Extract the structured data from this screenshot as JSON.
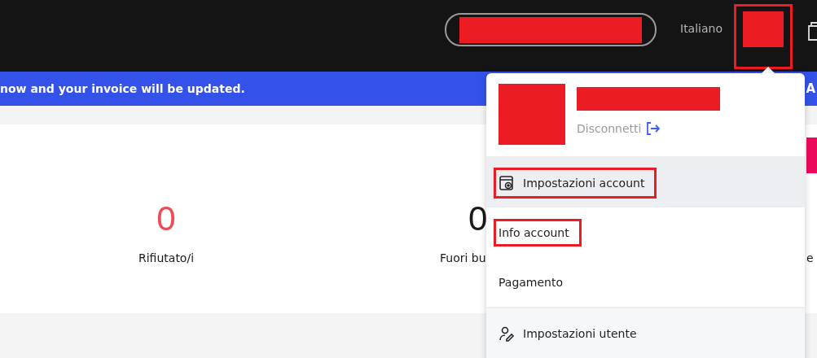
{
  "header": {
    "language": "Italiano",
    "avatar_annotated": true
  },
  "banner": {
    "text": "now and your invoice will be updated.",
    "trailing": "A"
  },
  "stats": [
    {
      "value": "0",
      "label": "Rifiutato/i",
      "color": "#f04a55"
    },
    {
      "value": "0",
      "label": "Fuori bu",
      "color": "#1a1a1a"
    },
    {
      "label": "e"
    }
  ],
  "account_menu": {
    "logout": "Disconnetti",
    "items": [
      {
        "label": "Impostazioni account",
        "selected": true,
        "annotated": true
      },
      {
        "label": "Info account",
        "selected": false,
        "annotated": true
      },
      {
        "label": "Pagamento",
        "selected": false,
        "annotated": false
      }
    ],
    "footer_item": {
      "label": "Impostazioni utente"
    }
  }
}
